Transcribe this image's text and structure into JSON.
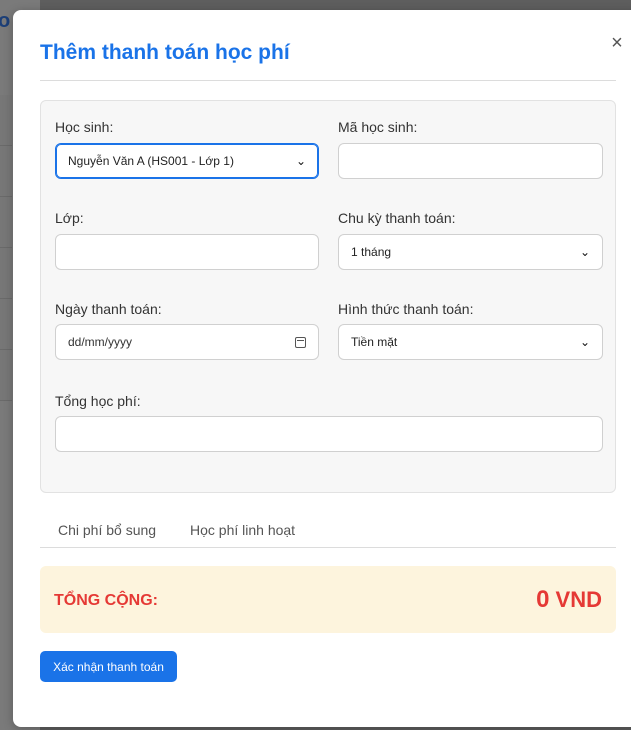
{
  "modal": {
    "title": "Thêm thanh toán học phí",
    "close_icon": "×"
  },
  "form": {
    "student": {
      "label": "Học sinh:",
      "value": "Nguyễn Văn A (HS001 - Lớp 1)"
    },
    "student_id": {
      "label": "Mã học sinh:",
      "value": ""
    },
    "class": {
      "label": "Lớp:",
      "value": ""
    },
    "payment_cycle": {
      "label": "Chu kỳ thanh toán:",
      "value": "1 tháng"
    },
    "payment_date": {
      "label": "Ngày thanh toán:",
      "placeholder": "dd/mm/yyyy"
    },
    "payment_method": {
      "label": "Hình thức thanh toán:",
      "value": "Tiền mặt"
    },
    "total_fee": {
      "label": "Tổng học phí:",
      "value": ""
    }
  },
  "tabs": [
    {
      "label": "Chi phí bổ sung"
    },
    {
      "label": "Học phí linh hoạt"
    }
  ],
  "summary": {
    "label": "TỔNG CỘNG:",
    "amount": "0",
    "currency": "VND"
  },
  "actions": {
    "confirm_label": "Xác nhận thanh toán"
  },
  "background": {
    "glyph": "o"
  },
  "colors": {
    "accent": "#1a73e8",
    "total_red": "#e53935",
    "total_bg": "#fdf4dd"
  }
}
